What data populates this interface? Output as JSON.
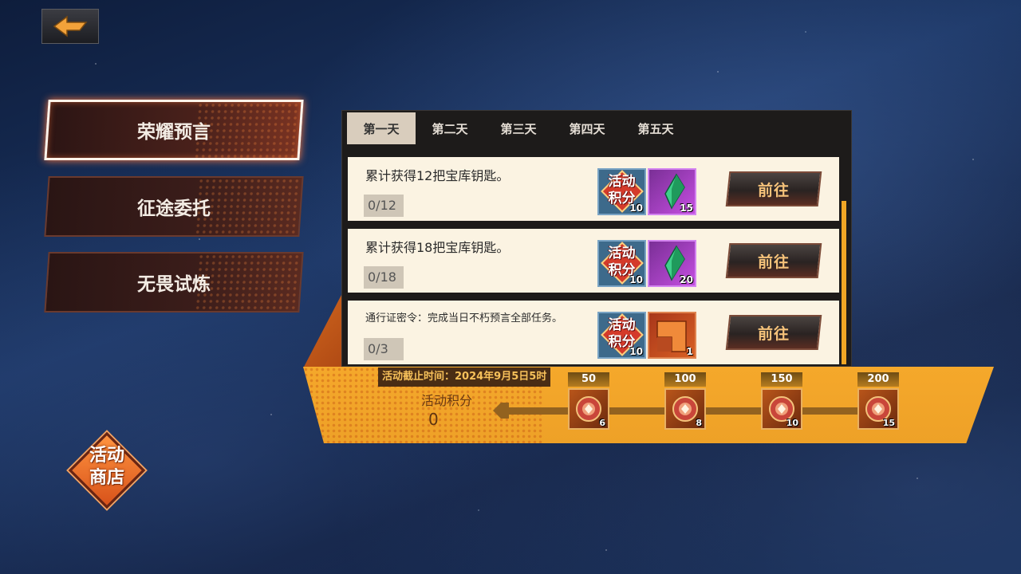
{
  "menu": {
    "items": [
      {
        "label": "荣耀预言",
        "active": true
      },
      {
        "label": "征途委托",
        "active": false
      },
      {
        "label": "无畏试炼",
        "active": false
      }
    ]
  },
  "shop": {
    "label_line1": "活动",
    "label_line2": "商店"
  },
  "tabs": [
    {
      "label": "第一天",
      "active": true
    },
    {
      "label": "第二天",
      "active": false
    },
    {
      "label": "第三天",
      "active": false
    },
    {
      "label": "第四天",
      "active": false
    },
    {
      "label": "第五天",
      "active": false
    }
  ],
  "tasks": [
    {
      "desc": "累计获得12把宝库钥匙。",
      "progress": "0/12",
      "points_line1": "活动",
      "points_line2": "积分",
      "points_count": "10",
      "item_icon": "green-crystal-icon",
      "item_count": "15",
      "button": "前往"
    },
    {
      "desc": "累计获得18把宝库钥匙。",
      "progress": "0/18",
      "points_line1": "活动",
      "points_line2": "积分",
      "points_count": "10",
      "item_icon": "green-crystal-icon",
      "item_count": "20",
      "button": "前往"
    },
    {
      "desc": "通行证密令：完成当日不朽预言全部任务。",
      "progress": "0/3",
      "points_line1": "活动",
      "points_line2": "积分",
      "points_count": "10",
      "item_icon": "orange-chip-icon",
      "item_count": "1",
      "button": "前往"
    }
  ],
  "bottom": {
    "deadline": "活动截止时间：2024年9月5日5时",
    "points_label": "活动积分",
    "points_value": "0",
    "milestones": [
      {
        "need": "50",
        "count": "6"
      },
      {
        "need": "100",
        "count": "8"
      },
      {
        "need": "150",
        "count": "10"
      },
      {
        "need": "200",
        "count": "15"
      }
    ]
  },
  "colors": {
    "accent": "#f5a82b",
    "button_text": "#f5c27a",
    "task_bg": "#fbf3e2"
  }
}
